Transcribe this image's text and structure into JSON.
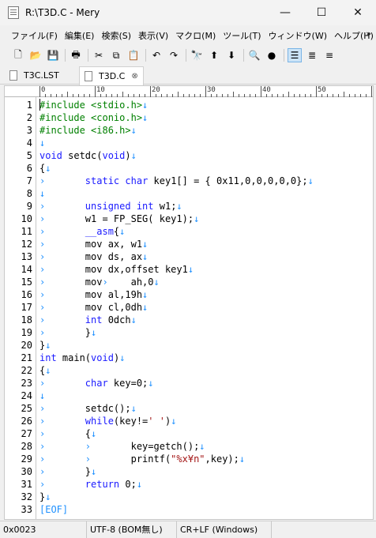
{
  "window": {
    "title": "R:\\T3D.C - Mery",
    "minimize_glyph": "—",
    "maximize_glyph": "☐",
    "close_glyph": "✕"
  },
  "menu": {
    "items": [
      {
        "label": "ファイル(F)"
      },
      {
        "label": "編集(E)"
      },
      {
        "label": "検索(S)"
      },
      {
        "label": "表示(V)"
      },
      {
        "label": "マクロ(M)"
      },
      {
        "label": "ツール(T)"
      },
      {
        "label": "ウィンドウ(W)"
      },
      {
        "label": "ヘルプ(H)"
      }
    ],
    "overflow": "»"
  },
  "toolbar": {
    "icons": [
      {
        "name": "new-file-icon",
        "glyph": "🗋"
      },
      {
        "name": "open-folder-icon",
        "glyph": "📂"
      },
      {
        "name": "save-icon",
        "glyph": "💾"
      },
      {
        "name": "print-icon",
        "glyph": "🖶"
      },
      {
        "name": "cut-icon",
        "glyph": "✂"
      },
      {
        "name": "copy-icon",
        "glyph": "⧉"
      },
      {
        "name": "paste-icon",
        "glyph": "📋"
      },
      {
        "name": "undo-icon",
        "glyph": "↶"
      },
      {
        "name": "redo-icon",
        "glyph": "↷"
      },
      {
        "name": "find-icon",
        "glyph": "🔭"
      },
      {
        "name": "find-previous-icon",
        "glyph": "⬆"
      },
      {
        "name": "find-next-icon",
        "glyph": "⬇"
      },
      {
        "name": "search-files-icon",
        "glyph": "🔍"
      },
      {
        "name": "record-macro-icon",
        "glyph": "●"
      },
      {
        "name": "no-wrap-icon",
        "glyph": "☰"
      },
      {
        "name": "wrap-window-icon",
        "glyph": "≣"
      },
      {
        "name": "wrap-column-icon",
        "glyph": "≡"
      }
    ]
  },
  "tabs": [
    {
      "label": "T3C.LST"
    },
    {
      "label": "T3D.C",
      "close": "⊗"
    }
  ],
  "ruler": {
    "labels": [
      "0",
      "10",
      "20",
      "30",
      "40",
      "50"
    ]
  },
  "colors": {
    "keyword": "#1a1aff",
    "preprocessor": "#008000",
    "string": "#a31515",
    "marks": "#1e90ff"
  },
  "lines": [
    {
      "no": "1",
      "segs": [
        [
          "pp",
          "#include <stdio.h>"
        ],
        [
          "mark",
          "↓"
        ]
      ]
    },
    {
      "no": "2",
      "segs": [
        [
          "pp",
          "#include <conio.h>"
        ],
        [
          "mark",
          "↓"
        ]
      ]
    },
    {
      "no": "3",
      "segs": [
        [
          "pp",
          "#include <i86.h>"
        ],
        [
          "mark",
          "↓"
        ]
      ]
    },
    {
      "no": "4",
      "segs": [
        [
          "mark",
          "↓"
        ]
      ]
    },
    {
      "no": "5",
      "segs": [
        [
          "kw",
          "void"
        ],
        [
          "",
          " setdc("
        ],
        [
          "kw",
          "void"
        ],
        [
          "",
          ")"
        ],
        [
          "mark",
          "↓"
        ]
      ]
    },
    {
      "no": "6",
      "segs": [
        [
          "",
          "{"
        ],
        [
          "mark",
          "↓"
        ]
      ]
    },
    {
      "no": "7",
      "segs": [
        [
          "mark",
          "›       "
        ],
        [
          "kw",
          "static"
        ],
        [
          "",
          " "
        ],
        [
          "kw",
          "char"
        ],
        [
          "",
          " key1[] = { 0x11,0,0,0,0,0};"
        ],
        [
          "mark",
          "↓"
        ]
      ]
    },
    {
      "no": "8",
      "segs": [
        [
          "mark",
          "↓"
        ]
      ]
    },
    {
      "no": "9",
      "segs": [
        [
          "mark",
          "›       "
        ],
        [
          "kw",
          "unsigned"
        ],
        [
          "",
          " "
        ],
        [
          "kw",
          "int"
        ],
        [
          "",
          " w1;"
        ],
        [
          "mark",
          "↓"
        ]
      ]
    },
    {
      "no": "10",
      "segs": [
        [
          "mark",
          "›       "
        ],
        [
          "",
          "w1 = FP_SEG( key1);"
        ],
        [
          "mark",
          "↓"
        ]
      ]
    },
    {
      "no": "11",
      "segs": [
        [
          "mark",
          "›       "
        ],
        [
          "kw",
          "__asm"
        ],
        [
          "",
          "{"
        ],
        [
          "mark",
          "↓"
        ]
      ]
    },
    {
      "no": "12",
      "segs": [
        [
          "mark",
          "›       "
        ],
        [
          "",
          "mov ax, w1"
        ],
        [
          "mark",
          "↓"
        ]
      ]
    },
    {
      "no": "13",
      "segs": [
        [
          "mark",
          "›       "
        ],
        [
          "",
          "mov ds, ax"
        ],
        [
          "mark",
          "↓"
        ]
      ]
    },
    {
      "no": "14",
      "segs": [
        [
          "mark",
          "›       "
        ],
        [
          "",
          "mov dx,offset key1"
        ],
        [
          "mark",
          "↓"
        ]
      ]
    },
    {
      "no": "15",
      "segs": [
        [
          "mark",
          "›       "
        ],
        [
          "",
          "mov"
        ],
        [
          "mark",
          "›    "
        ],
        [
          "",
          "ah,0"
        ],
        [
          "mark",
          "↓"
        ]
      ]
    },
    {
      "no": "16",
      "segs": [
        [
          "mark",
          "›       "
        ],
        [
          "",
          "mov al,19h"
        ],
        [
          "mark",
          "↓"
        ]
      ]
    },
    {
      "no": "17",
      "segs": [
        [
          "mark",
          "›       "
        ],
        [
          "",
          "mov cl,0dh"
        ],
        [
          "mark",
          "↓"
        ]
      ]
    },
    {
      "no": "18",
      "segs": [
        [
          "mark",
          "›       "
        ],
        [
          "kw",
          "int"
        ],
        [
          "",
          " 0dch"
        ],
        [
          "mark",
          "↓"
        ]
      ]
    },
    {
      "no": "19",
      "segs": [
        [
          "mark",
          "›       "
        ],
        [
          "",
          "}"
        ],
        [
          "mark",
          "↓"
        ]
      ]
    },
    {
      "no": "20",
      "segs": [
        [
          "",
          "}"
        ],
        [
          "mark",
          "↓"
        ]
      ]
    },
    {
      "no": "21",
      "segs": [
        [
          "kw",
          "int"
        ],
        [
          "",
          " main("
        ],
        [
          "kw",
          "void"
        ],
        [
          "",
          ")"
        ],
        [
          "mark",
          "↓"
        ]
      ]
    },
    {
      "no": "22",
      "segs": [
        [
          "",
          "{"
        ],
        [
          "mark",
          "↓"
        ]
      ]
    },
    {
      "no": "23",
      "segs": [
        [
          "mark",
          "›       "
        ],
        [
          "kw",
          "char"
        ],
        [
          "",
          " key=0;"
        ],
        [
          "mark",
          "↓"
        ]
      ]
    },
    {
      "no": "24",
      "segs": [
        [
          "mark",
          "↓"
        ]
      ]
    },
    {
      "no": "25",
      "segs": [
        [
          "mark",
          "›       "
        ],
        [
          "",
          "setdc();"
        ],
        [
          "mark",
          "↓"
        ]
      ]
    },
    {
      "no": "26",
      "segs": [
        [
          "mark",
          "›       "
        ],
        [
          "kw",
          "while"
        ],
        [
          "",
          "(key!="
        ],
        [
          "str",
          "' '"
        ],
        [
          "",
          ")"
        ],
        [
          "mark",
          "↓"
        ]
      ]
    },
    {
      "no": "27",
      "segs": [
        [
          "mark",
          "›       "
        ],
        [
          "",
          "{"
        ],
        [
          "mark",
          "↓"
        ]
      ]
    },
    {
      "no": "28",
      "segs": [
        [
          "mark",
          "›       ›       "
        ],
        [
          "",
          "key=getch();"
        ],
        [
          "mark",
          "↓"
        ]
      ]
    },
    {
      "no": "29",
      "segs": [
        [
          "mark",
          "›       ›       "
        ],
        [
          "",
          "printf("
        ],
        [
          "str",
          "\"%x¥n\""
        ],
        [
          "",
          ",key);"
        ],
        [
          "mark",
          "↓"
        ]
      ]
    },
    {
      "no": "30",
      "segs": [
        [
          "mark",
          "›       "
        ],
        [
          "",
          "}"
        ],
        [
          "mark",
          "↓"
        ]
      ]
    },
    {
      "no": "31",
      "segs": [
        [
          "mark",
          "›       "
        ],
        [
          "kw",
          "return"
        ],
        [
          "",
          " 0;"
        ],
        [
          "mark",
          "↓"
        ]
      ]
    },
    {
      "no": "32",
      "segs": [
        [
          "",
          "}"
        ],
        [
          "mark",
          "↓"
        ]
      ]
    },
    {
      "no": "33",
      "segs": [
        [
          "eof",
          "[EOF]"
        ]
      ]
    }
  ],
  "status": {
    "position": "0x0023",
    "encoding": "UTF-8 (BOM無し)",
    "line_ending": "CR+LF (Windows)"
  }
}
